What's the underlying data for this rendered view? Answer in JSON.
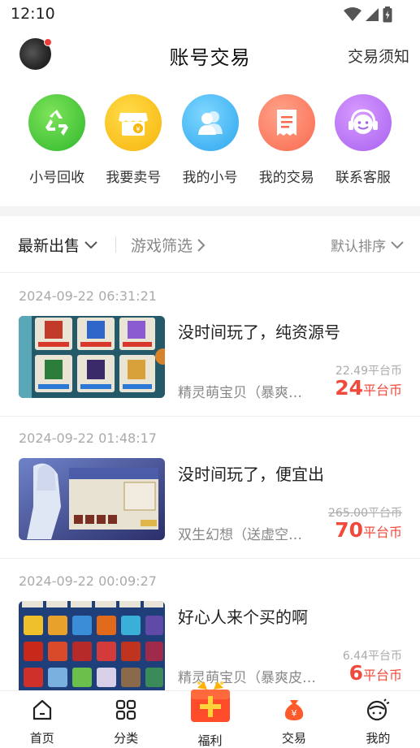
{
  "status_bar": {
    "time": "12:10",
    "icons": [
      "wifi-icon",
      "signal-icon",
      "battery-icon"
    ]
  },
  "header": {
    "title": "账号交易",
    "notice": "交易须知"
  },
  "quick_menu": [
    {
      "label": "小号回收",
      "icon": "recycle-icon",
      "color": "#3fc73a"
    },
    {
      "label": "我要卖号",
      "icon": "shop-icon",
      "color": "#fbbd12"
    },
    {
      "label": "我的小号",
      "icon": "users-icon",
      "color": "#3fb0f0"
    },
    {
      "label": "我的交易",
      "icon": "receipt-icon",
      "color": "#fb7a62"
    },
    {
      "label": "联系客服",
      "icon": "headset-icon",
      "color": "#b26ef2"
    }
  ],
  "filters": {
    "latest": "最新出售",
    "game_filter": "游戏筛选",
    "sort": "默认排序"
  },
  "listings": [
    {
      "date": "2024-09-22 06:31:21",
      "title": "没时间玩了，纯资源号",
      "game": "精灵萌宝贝（暴爽皮…",
      "original_price": "22.49平台币",
      "original_strike": false,
      "price": "24",
      "unit": "平台币"
    },
    {
      "date": "2024-09-22 01:48:17",
      "title": "没时间玩了，便宜出",
      "game": "双生幻想（送虚空无…",
      "original_price": "265.00平台币",
      "original_strike": true,
      "price": "70",
      "unit": "平台币"
    },
    {
      "date": "2024-09-22 00:09:27",
      "title": "好心人来个买的啊",
      "game": "精灵萌宝贝（暴爽皮卡0…",
      "original_price": "6.44平台币",
      "original_strike": false,
      "price": "6",
      "unit": "平台币"
    }
  ],
  "tab_bar": [
    {
      "label": "首页",
      "icon": "home-icon"
    },
    {
      "label": "分类",
      "icon": "category-icon"
    },
    {
      "label": "福利",
      "icon": "gift-icon"
    },
    {
      "label": "交易",
      "icon": "money-bag-icon"
    },
    {
      "label": "我的",
      "icon": "profile-icon"
    }
  ],
  "colors": {
    "price_red": "#f04a3c",
    "accent_orange": "#ff5a2c"
  }
}
